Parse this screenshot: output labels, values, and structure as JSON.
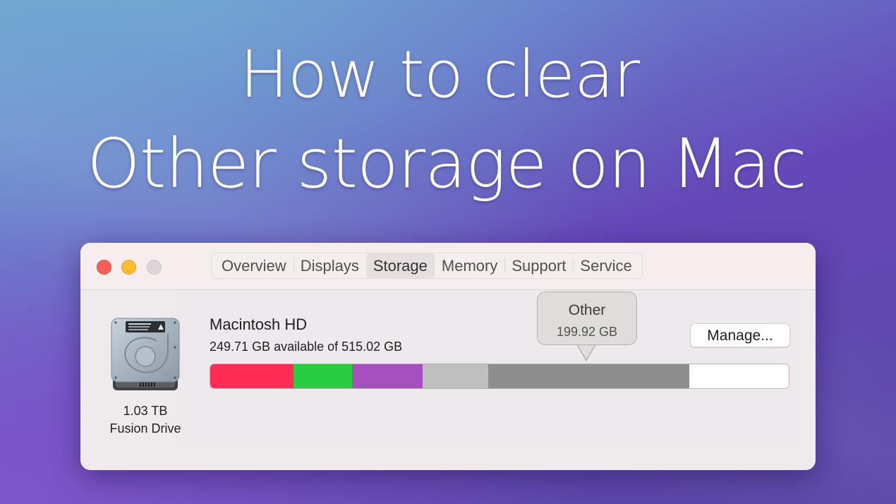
{
  "headline": {
    "line1": "How to clear",
    "line2": "Other storage on Mac"
  },
  "window": {
    "traffic_lights": [
      {
        "name": "close",
        "color": "#fe5f57"
      },
      {
        "name": "minimize",
        "color": "#febc2e"
      },
      {
        "name": "zoom",
        "color": "#ddd6d6"
      }
    ],
    "tabs": [
      {
        "label": "Overview",
        "active": false
      },
      {
        "label": "Displays",
        "active": false
      },
      {
        "label": "Storage",
        "active": true
      },
      {
        "label": "Memory",
        "active": false
      },
      {
        "label": "Support",
        "active": false
      },
      {
        "label": "Service",
        "active": false
      }
    ],
    "drive": {
      "icon": "hard-drive-icon",
      "size": "1.03 TB",
      "type": "Fusion Drive"
    },
    "volume": {
      "name": "Macintosh HD",
      "available": "249.71 GB available of 515.02 GB"
    },
    "manage_button": "Manage...",
    "tooltip": {
      "title": "Other",
      "value": "199.92 GB"
    },
    "storage_bar": {
      "segments": [
        {
          "name": "category-red",
          "color": "#ff2d55",
          "fraction": 0.144
        },
        {
          "name": "category-green",
          "color": "#28cd41",
          "fraction": 0.101
        },
        {
          "name": "category-purple",
          "color": "#a550bd",
          "fraction": 0.122
        },
        {
          "name": "category-light-gray",
          "color": "#bfbfbf",
          "fraction": 0.113
        },
        {
          "name": "category-other",
          "color": "#8e8e8e",
          "fraction": 0.348
        },
        {
          "name": "free-space",
          "color": "#ffffff",
          "fraction": 0.172
        }
      ]
    }
  }
}
